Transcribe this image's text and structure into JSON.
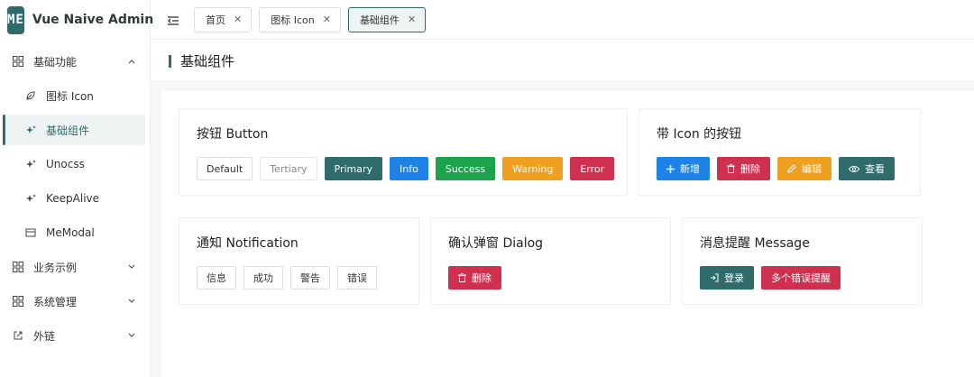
{
  "app": {
    "logo_text": "ME",
    "title": "Vue Naive Admin"
  },
  "sidebar": {
    "items": [
      {
        "label": "基础功能",
        "icon": "grid-icon",
        "expanded": true
      },
      {
        "label": "图标 Icon",
        "icon": "leaf-icon"
      },
      {
        "label": "基础组件",
        "icon": "sparkle-icon",
        "active": true
      },
      {
        "label": "Unocss",
        "icon": "sparkle-icon"
      },
      {
        "label": "KeepAlive",
        "icon": "sparkle-icon"
      },
      {
        "label": "MeModal",
        "icon": "window-icon"
      },
      {
        "label": "业务示例",
        "icon": "grid-icon"
      },
      {
        "label": "系统管理",
        "icon": "grid-icon"
      },
      {
        "label": "外链",
        "icon": "external-link-icon"
      }
    ]
  },
  "tabs": [
    {
      "label": "首页"
    },
    {
      "label": "图标 Icon"
    },
    {
      "label": "基础组件",
      "active": true
    }
  ],
  "page": {
    "title": "基础组件"
  },
  "cards": {
    "button": {
      "title": "按钮 Button",
      "buttons": [
        "Default",
        "Tertiary",
        "Primary",
        "Info",
        "Success",
        "Warning",
        "Error"
      ]
    },
    "icon_button": {
      "title": "带 Icon 的按钮",
      "buttons": [
        "新增",
        "删除",
        "编辑",
        "查看"
      ]
    },
    "notification": {
      "title": "通知 Notification",
      "buttons": [
        "信息",
        "成功",
        "警告",
        "错误"
      ]
    },
    "dialog": {
      "title": "确认弹窗 Dialog",
      "buttons": [
        "删除"
      ]
    },
    "message": {
      "title": "消息提醒 Message",
      "buttons": [
        "登录",
        "多个错误提醒"
      ]
    }
  },
  "colors": {
    "primary": "#2f6b6b",
    "info": "#1f82e6",
    "success": "#1ea34d",
    "warning": "#f0a020",
    "error": "#d03050"
  }
}
